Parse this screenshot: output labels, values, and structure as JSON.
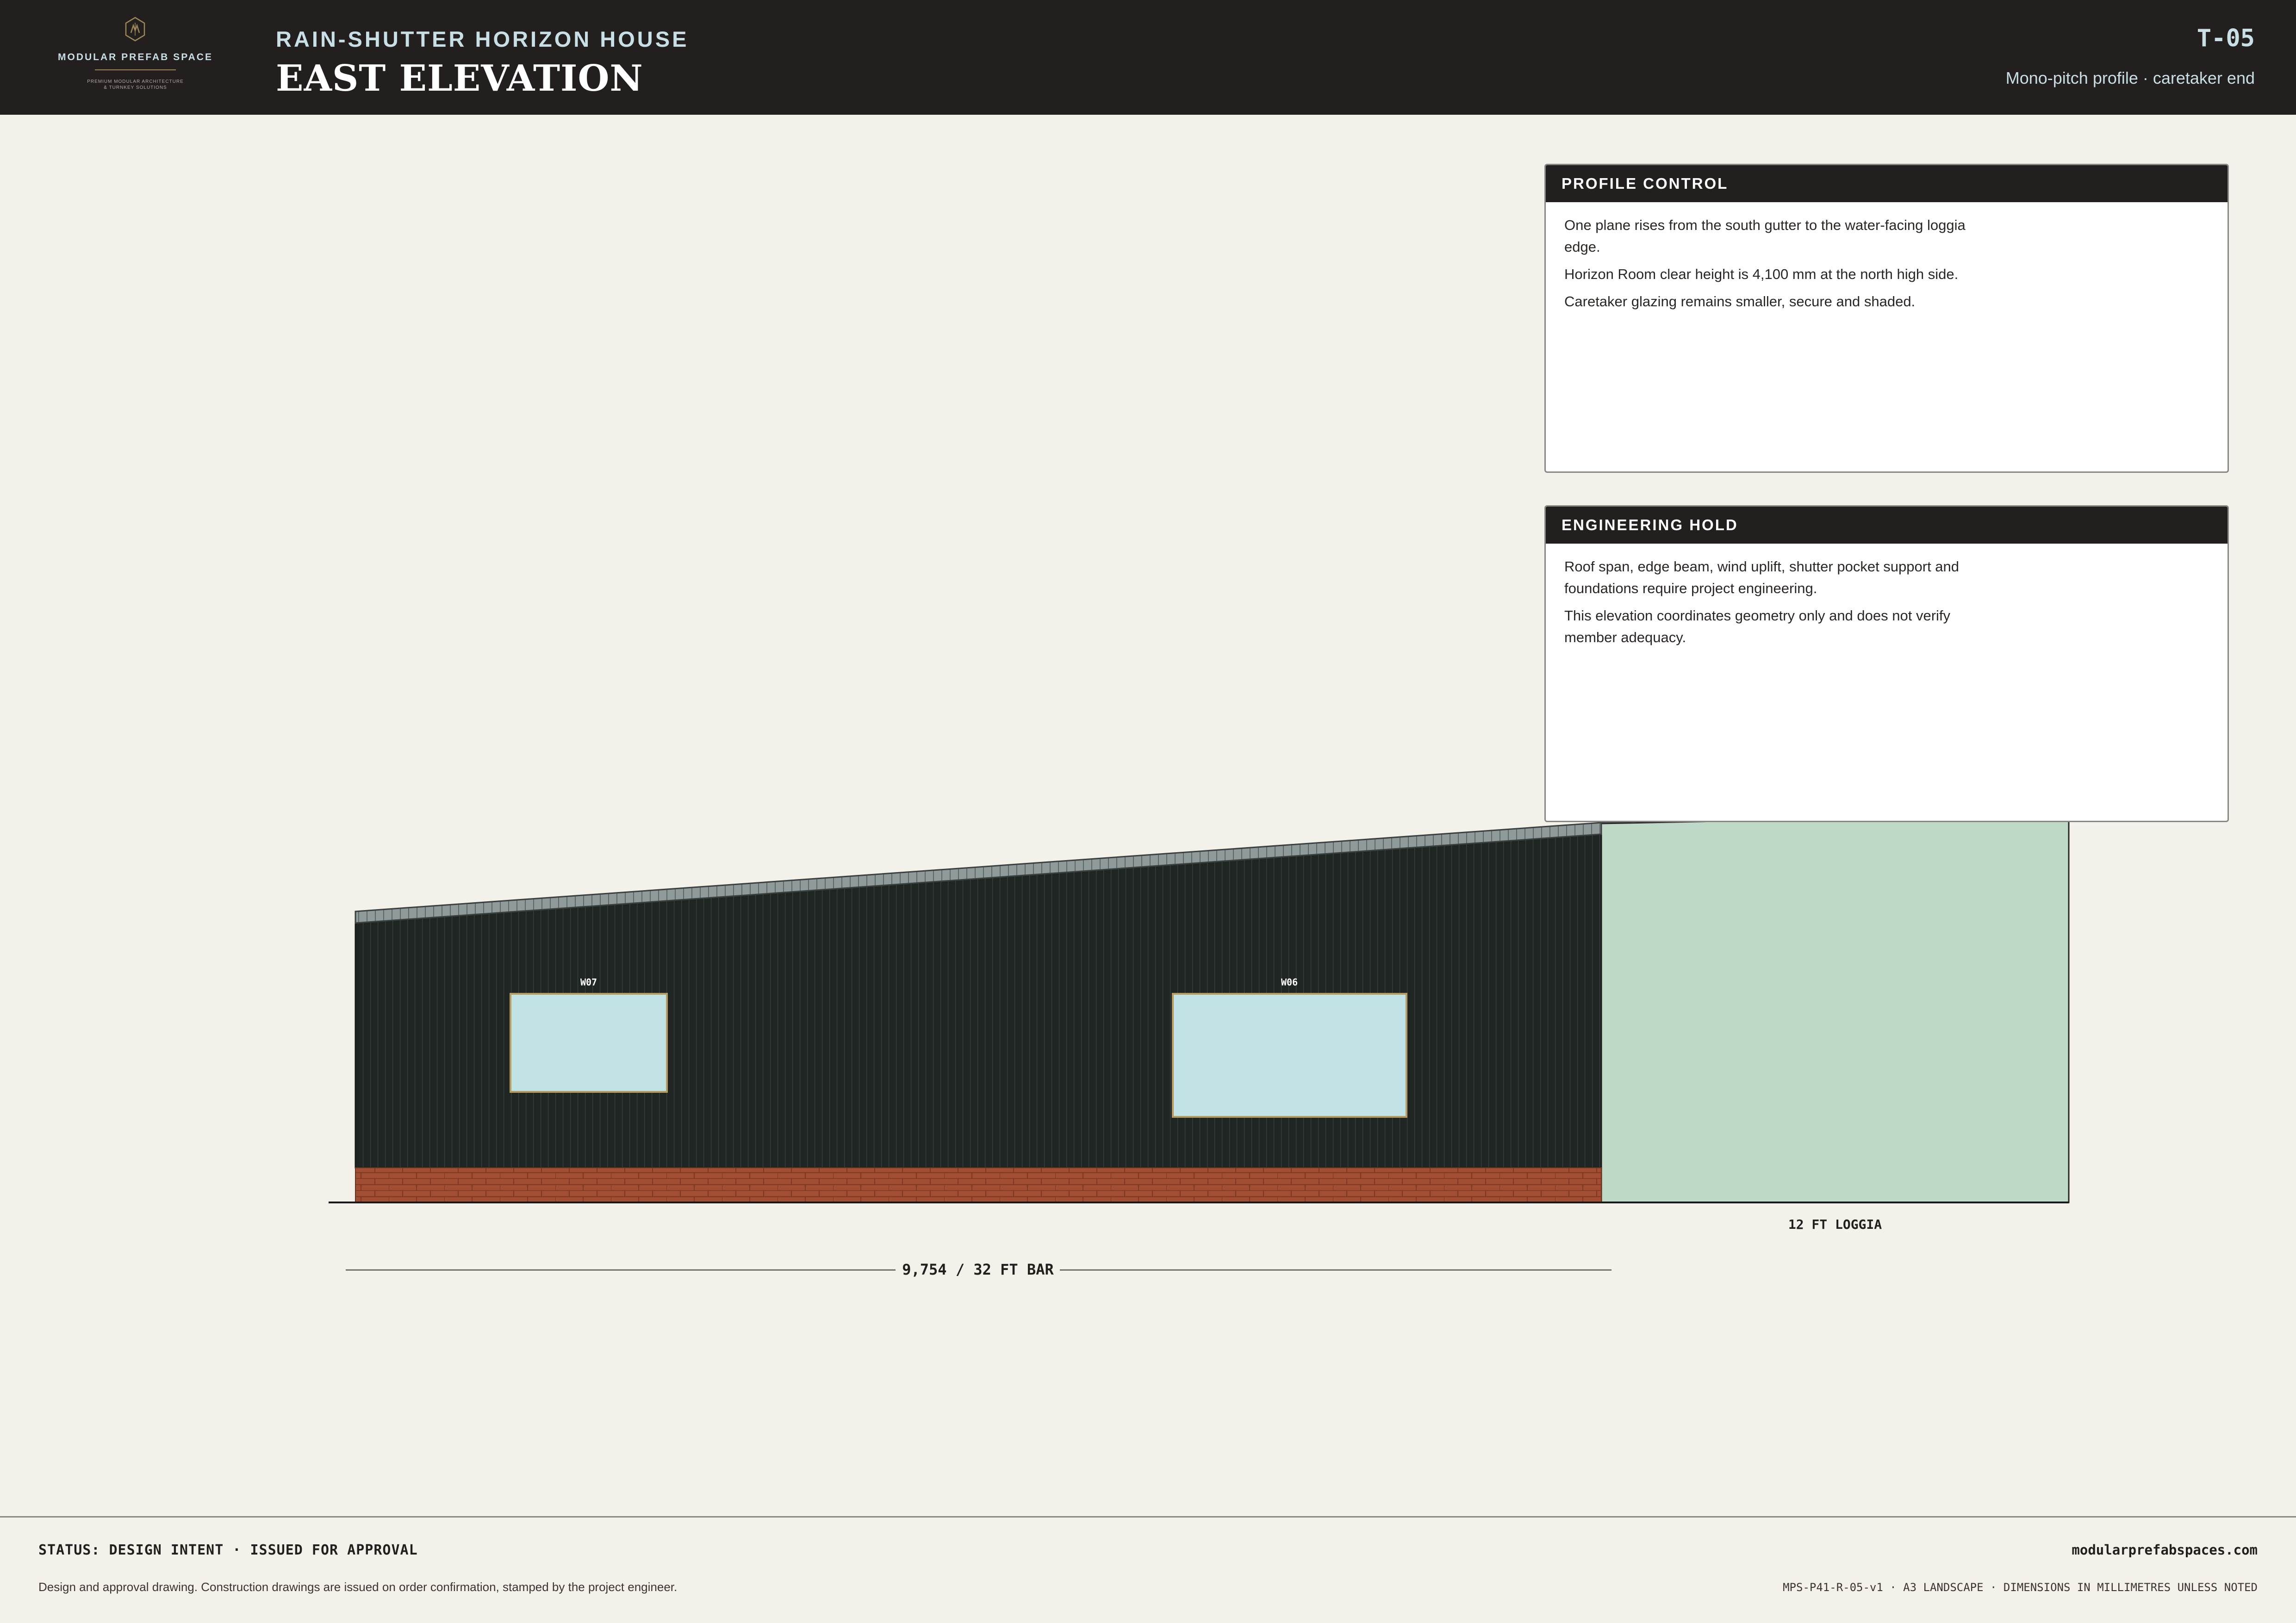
{
  "brand": {
    "name": "MODULAR PREFAB SPACE",
    "tagline_line1": "PREMIUM MODULAR ARCHITECTURE",
    "tagline_line2": "& TURNKEY SOLUTIONS",
    "logo_icon": "hexagon-monogram-icon"
  },
  "header": {
    "project": "RAIN-SHUTTER HORIZON HOUSE",
    "title": "EAST ELEVATION",
    "sheet_number": "T-05",
    "subtitle": "Mono-pitch profile · caretaker end"
  },
  "notes": [
    {
      "heading": "PROFILE CONTROL",
      "lines": [
        "One plane rises from the south gutter to the water-facing loggia edge.",
        "Horizon Room clear height is 4,100 mm at the north high side.",
        "Caretaker glazing remains smaller, secure and shaded."
      ]
    },
    {
      "heading": "ENGINEERING HOLD",
      "lines": [
        "Roof span, edge beam, wind uplift, shutter pocket support and foundations require project engineering.",
        "This elevation coordinates geometry only and does not verify member adequacy."
      ]
    }
  ],
  "drawing": {
    "window_left": "W07",
    "window_right": "W06",
    "loggia_label": "12 FT LOGGIA",
    "bar_dimension": "9,754 / 32 FT BAR"
  },
  "colors": {
    "header_bg": "#231f1e",
    "accent_light_blue": "#c9dfe6",
    "cladding": "#1e2523",
    "glazing": "#c2e3e6",
    "brick_plinth": "#a24e33",
    "loggia": "#bfd9c7",
    "paper": "#f3f1e9"
  },
  "footer": {
    "status": "STATUS: DESIGN INTENT · ISSUED FOR APPROVAL",
    "disclaimer": "Design and approval drawing. Construction drawings are issued on order confirmation, stamped by the project engineer.",
    "website": "modularprefabspaces.com",
    "doc_ref": "MPS-P41-R-05-v1 · A3 LANDSCAPE · DIMENSIONS IN MILLIMETRES UNLESS NOTED"
  }
}
